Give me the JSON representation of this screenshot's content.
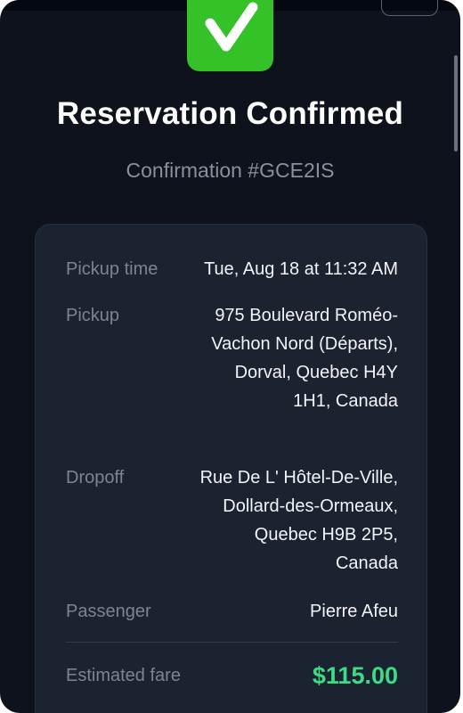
{
  "colors": {
    "background": "#0d121c",
    "card": "#1b2230",
    "success_green": "#34c228",
    "fare_green": "#3ddc84",
    "label_gray": "#7d8493",
    "value_white": "#f2f4f7"
  },
  "header": {
    "icon": "checkmark-icon",
    "title": "Reservation Confirmed",
    "confirmation": "Confirmation #GCE2IS"
  },
  "details": {
    "pickup_time": {
      "label": "Pickup time",
      "value": "Tue, Aug 18 at 11:32 AM"
    },
    "pickup": {
      "label": "Pickup",
      "value": "975 Boulevard Roméo-Vachon Nord (Départs), Dorval, Quebec H4Y 1H1, Canada"
    },
    "dropoff": {
      "label": "Dropoff",
      "value": "Rue De L' Hôtel-De-Ville, Dollard-des-Ormeaux, Quebec H9B 2P5, Canada"
    },
    "passenger": {
      "label": "Passenger",
      "value": "Pierre Afeu"
    },
    "fare": {
      "label": "Estimated fare",
      "value": "$115.00"
    }
  }
}
